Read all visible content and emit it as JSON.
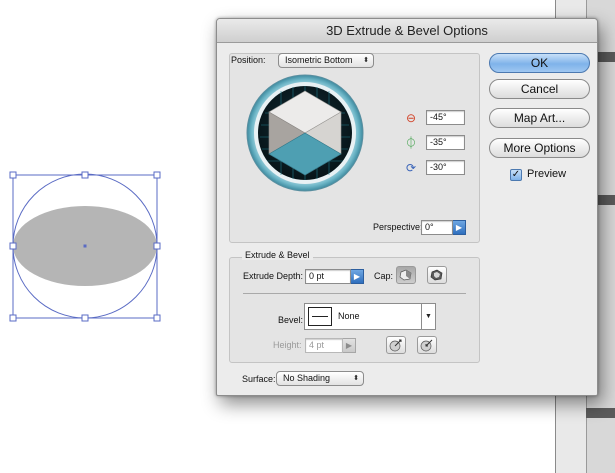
{
  "dialog": {
    "title": "3D Extrude & Bevel Options",
    "buttons": {
      "ok": "OK",
      "cancel": "Cancel",
      "map_art": "Map Art...",
      "more_options": "More Options"
    },
    "preview": {
      "label": "Preview",
      "checked": true
    }
  },
  "position": {
    "label": "Position:",
    "value": "Isometric Bottom",
    "rotation_x": "-45°",
    "rotation_y": "-35°",
    "rotation_z": "-30°",
    "perspective_label": "Perspective:",
    "perspective_value": "0°"
  },
  "extrude_bevel": {
    "group_label": "Extrude & Bevel",
    "extrude_depth_label": "Extrude Depth:",
    "extrude_depth_value": "0 pt",
    "cap_label": "Cap:",
    "bevel_label": "Bevel:",
    "bevel_value": "None",
    "height_label": "Height:",
    "height_value": "4 pt"
  },
  "surface": {
    "label": "Surface:",
    "value": "No Shading"
  },
  "icons": {
    "rotate_x": "rotate-x-axis-icon",
    "rotate_y": "rotate-y-axis-icon",
    "rotate_z": "rotate-z-axis-icon",
    "cap_on": "cap-on-icon",
    "cap_off": "cap-off-icon",
    "bevel_out": "bevel-extent-out-icon",
    "bevel_in": "bevel-extent-in-icon"
  },
  "colors": {
    "cube_front": "#4e9fb2",
    "cube_left": "#a8a4a0",
    "cube_right": "#d6d4d1",
    "ellipse_fill": "#b5b5b5",
    "selection": "#5a6bc4",
    "rotation_accent": "#d2442a"
  }
}
